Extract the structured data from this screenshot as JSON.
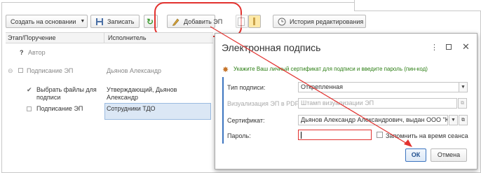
{
  "toolbar": {
    "create_based_on": "Создать на основании",
    "save": "Записать",
    "add_ep": "Добавить ЭП",
    "history": "История редактирования"
  },
  "grid": {
    "columns": [
      "Этап/Поручение",
      "Исполнитель"
    ],
    "rows": [
      {
        "stage": "Автор",
        "executor": ""
      },
      {
        "stage": "Подписание ЭП",
        "executor": "Дьянов Александр"
      },
      {
        "stage": "Выбрать файлы для подписи",
        "stage_line1": "Выбрать файлы для",
        "stage_line2": "подписи",
        "executor_line1": "Утверждающий, Дьянов",
        "executor_line2": "Александр"
      },
      {
        "stage": "Подписание ЭП",
        "executor": "Сотрудники ТДО"
      }
    ]
  },
  "dialog": {
    "title": "Электронная подпись",
    "hint": "Укажите Ваш личный сертификат для подписи и введите пароль (пин-код)",
    "fields": {
      "sign_type_label": "Тип подписи:",
      "sign_type_value": "Открепленная",
      "visual_label": "Визуализация ЭП в PDF:",
      "visual_value": "Штамп визуализации ЭП",
      "cert_label": "Сертификат:",
      "cert_value": "Дьянов Александр Александрович, выдан ООО \"Ко",
      "password_label": "Пароль:",
      "password_value": "",
      "remember_label": "Запомнить на время сеанса"
    },
    "ok": "ОК",
    "cancel": "Отмена"
  },
  "colors": {
    "highlight": "#e2322f",
    "ok_blue": "#3d75c0",
    "selected_row": "#dbe7f5"
  }
}
